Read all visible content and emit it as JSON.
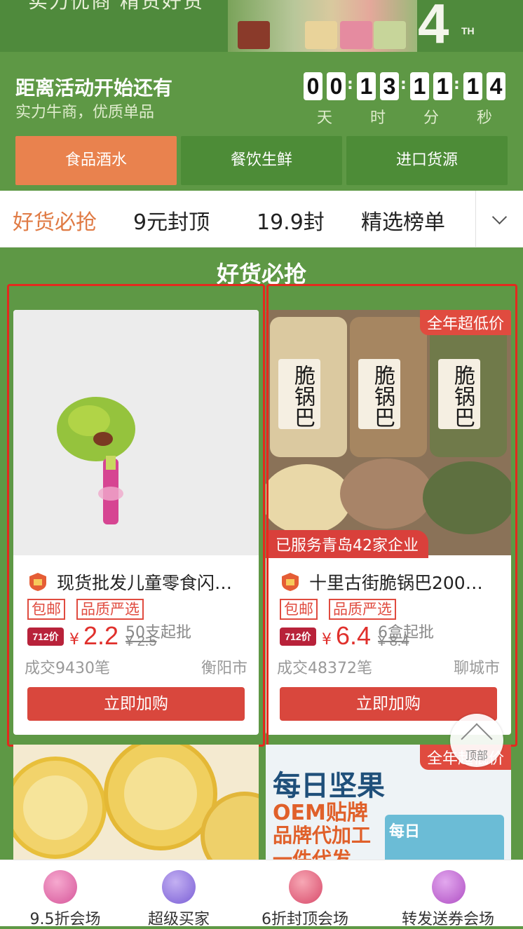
{
  "banner": {
    "text": "实力优商 精货好货",
    "anniversary_number": "4",
    "anniversary_suffix": "TH"
  },
  "countdown": {
    "title": "距离活动开始还有",
    "subtitle": "实力牛商，优质单品",
    "digits": [
      "0",
      "0",
      "1",
      "3",
      "1",
      "1",
      "1",
      "4"
    ],
    "units": [
      "天",
      "时",
      "分",
      "秒"
    ]
  },
  "category_tabs": [
    {
      "label": "食品酒水",
      "active": true
    },
    {
      "label": "餐饮生鲜",
      "active": false
    },
    {
      "label": "进口货源",
      "active": false
    }
  ],
  "subnav": [
    {
      "label": "好货必抢",
      "active": true
    },
    {
      "label": "9元封顶",
      "active": false
    },
    {
      "label": "19.9封",
      "active": false
    },
    {
      "label": "精选榜单",
      "active": false
    }
  ],
  "section_title": "好货必抢",
  "products": [
    {
      "name": "现货批发儿童零食闪…",
      "tags": [
        "包邮",
        "品质严选"
      ],
      "price_badge": "712价",
      "currency": "¥",
      "price": "2.2",
      "min_order": "50支起批",
      "old_price": "¥ 2.5",
      "deals": "成交9430笔",
      "city": "衡阳市",
      "buy_label": "立即加购"
    },
    {
      "name": "十里古街脆锅巴200…",
      "ribbon": "全年超低价",
      "serve_tag": "已服务青岛42家企业",
      "tags": [
        "包邮",
        "品质严选"
      ],
      "price_badge": "712价",
      "currency": "¥",
      "price": "6.4",
      "min_order": "6盒起批",
      "old_price": "¥ 8.4",
      "deals": "成交48372笔",
      "city": "聊城市",
      "buy_label": "立即加购",
      "jar_label": "脆锅巴"
    }
  ],
  "lower_cards": {
    "right_ribbon": "全年超低价",
    "right_title": "每日坚果",
    "right_line2": "OEM贴牌",
    "right_line3": "品牌代加工",
    "right_line4": "一件代发",
    "right_box_text": "每日"
  },
  "back_to_top": "顶部",
  "bottom_bar": [
    {
      "label": "9.5折会场",
      "icon": "tag-icon",
      "color": "#d6569a"
    },
    {
      "label": "超级买家",
      "icon": "diamond-icon",
      "color": "#7b5fd6"
    },
    {
      "label": "6折封顶会场",
      "icon": "percent-bag-icon",
      "color": "#d84a6a"
    },
    {
      "label": "转发送券会场",
      "icon": "coupon-icon",
      "color": "#b04fc4"
    }
  ]
}
